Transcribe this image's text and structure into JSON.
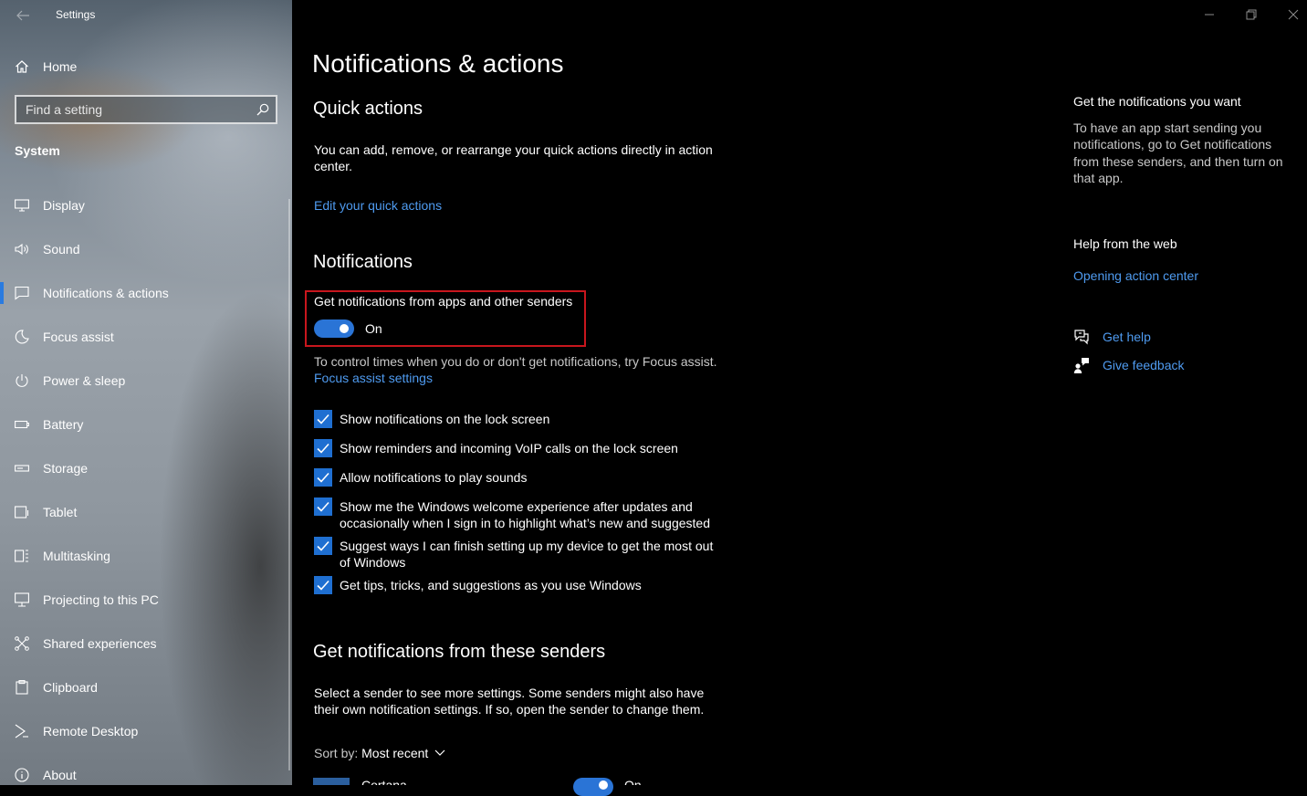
{
  "window": {
    "title": "Settings",
    "controls": [
      "minimize",
      "restore",
      "close"
    ]
  },
  "sidebar": {
    "home_label": "Home",
    "search_placeholder": "Find a setting",
    "section_title": "System",
    "selected_index": 2,
    "accent_color": "#2a7be0",
    "items": [
      {
        "label": "Display",
        "icon": "display-icon"
      },
      {
        "label": "Sound",
        "icon": "sound-icon"
      },
      {
        "label": "Notifications & actions",
        "icon": "notifications-icon"
      },
      {
        "label": "Focus assist",
        "icon": "moon-icon"
      },
      {
        "label": "Power & sleep",
        "icon": "power-icon"
      },
      {
        "label": "Battery",
        "icon": "battery-icon"
      },
      {
        "label": "Storage",
        "icon": "storage-icon"
      },
      {
        "label": "Tablet",
        "icon": "tablet-icon"
      },
      {
        "label": "Multitasking",
        "icon": "multitasking-icon"
      },
      {
        "label": "Projecting to this PC",
        "icon": "projecting-icon"
      },
      {
        "label": "Shared experiences",
        "icon": "shared-experiences-icon"
      },
      {
        "label": "Clipboard",
        "icon": "clipboard-icon"
      },
      {
        "label": "Remote Desktop",
        "icon": "remote-desktop-icon"
      },
      {
        "label": "About",
        "icon": "info-icon"
      }
    ]
  },
  "main": {
    "title": "Notifications & actions",
    "quick_actions": {
      "heading": "Quick actions",
      "description": "You can add, remove, or rearrange your quick actions directly in action center.",
      "link": "Edit your quick actions"
    },
    "notifications": {
      "heading": "Notifications",
      "toggle_label": "Get notifications from apps and other senders",
      "toggle_state": "On",
      "toggle_on": true,
      "focus_hint": "To control times when you do or don't get notifications, try Focus assist.",
      "focus_link": "Focus assist settings",
      "checkboxes": [
        {
          "label": "Show notifications on the lock screen",
          "checked": true
        },
        {
          "label": "Show reminders and incoming VoIP calls on the lock screen",
          "checked": true
        },
        {
          "label": "Allow notifications to play sounds",
          "checked": true
        },
        {
          "label": "Show me the Windows welcome experience after updates and occasionally when I sign in to highlight what’s new and suggested",
          "checked": true
        },
        {
          "label": "Suggest ways I can finish setting up my device to get the most out of Windows",
          "checked": true
        },
        {
          "label": "Get tips, tricks, and suggestions as you use Windows",
          "checked": true
        }
      ]
    },
    "senders": {
      "heading": "Get notifications from these senders",
      "description": "Select a sender to see more settings. Some senders might also have their own notification settings. If so, open the sender to change them.",
      "sort_prefix": "Sort by:",
      "sort_value": "Most recent",
      "first_sender": "Cortana",
      "first_sender_state": "On"
    }
  },
  "right_panel": {
    "get_notifications_heading": "Get the notifications you want",
    "get_notifications_text": "To have an app start sending you notifications, go to Get notifications from these senders, and then turn on that app.",
    "help_heading": "Help from the web",
    "help_link": "Opening action center",
    "get_help": "Get help",
    "give_feedback": "Give feedback"
  },
  "colors": {
    "background": "#000000",
    "accent": "#2a74d6",
    "link": "#4f9bf0",
    "highlight_border": "#c8161d"
  }
}
